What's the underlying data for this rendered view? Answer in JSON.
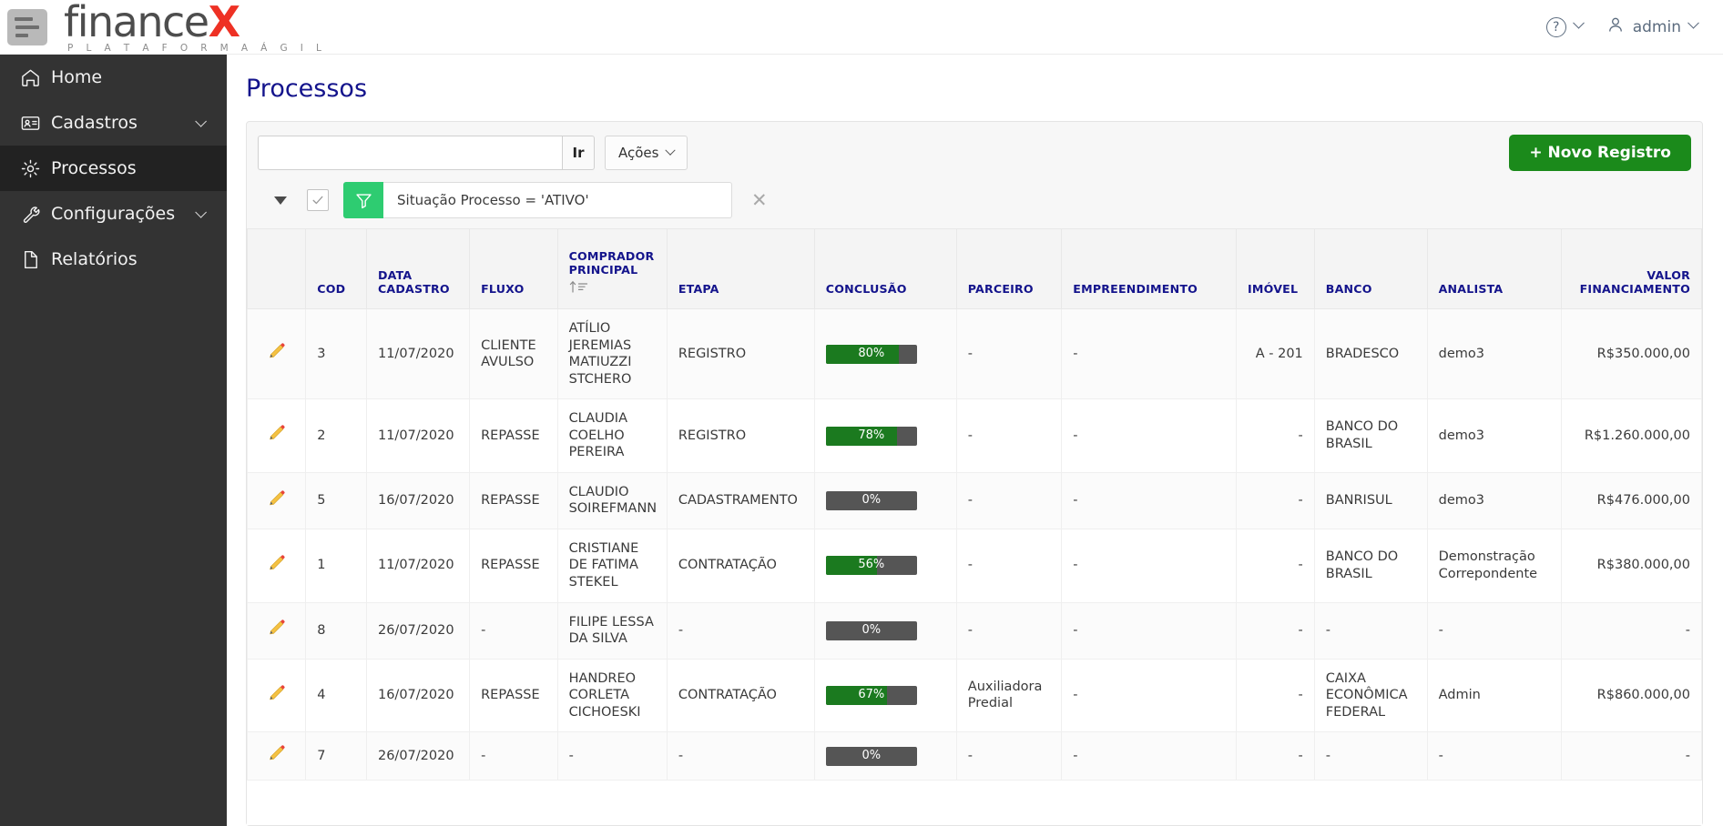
{
  "topbar": {
    "menu_icon": "hamburger-icon",
    "logo_main": "finance",
    "logo_x": "X",
    "logo_sub": "P L A T A F O R M A   Á G I L",
    "help_icon": "help-circle-icon",
    "help_glyph": "?",
    "user_icon": "user-icon",
    "user_label": "admin"
  },
  "sidebar": {
    "items": [
      {
        "label": "Home",
        "icon": "home-icon",
        "active": false,
        "has_chevron": false
      },
      {
        "label": "Cadastros",
        "icon": "id-card-icon",
        "active": false,
        "has_chevron": true
      },
      {
        "label": "Processos",
        "icon": "gear-icon",
        "active": true,
        "has_chevron": false
      },
      {
        "label": "Configurações",
        "icon": "wrench-icon",
        "active": false,
        "has_chevron": true
      },
      {
        "label": "Relatórios",
        "icon": "document-icon",
        "active": false,
        "has_chevron": false
      }
    ]
  },
  "page": {
    "title": "Processos"
  },
  "toolbar": {
    "search_value": "",
    "search_placeholder": "",
    "go_label": "Ir",
    "acoes_label": "Ações",
    "novo_registro_label": "+ Novo Registro"
  },
  "filter": {
    "toggle_icon": "triangle-down-icon",
    "checkbox_checked": true,
    "funnel_icon": "funnel-icon",
    "text": "Situação Processo = 'ATIVO'",
    "close_icon": "close-icon",
    "close_glyph": "✕"
  },
  "colors": {
    "accent_green": "#1b8a1b",
    "filter_green": "#2ecc71",
    "header_navy": "#14148c",
    "sidebar": "#333333",
    "sidebar_active": "#222222",
    "bar_track": "#555555",
    "bar_fill": "#1b7a1f",
    "logo_red": "#ee3124"
  },
  "table": {
    "columns": [
      {
        "key": "edit",
        "label": "",
        "align": "left",
        "sorted": false
      },
      {
        "key": "cod",
        "label": "COD",
        "align": "left",
        "sorted": false
      },
      {
        "key": "data",
        "label": "DATA CADASTRO",
        "align": "left",
        "sorted": false
      },
      {
        "key": "fluxo",
        "label": "FLUXO",
        "align": "left",
        "sorted": false
      },
      {
        "key": "comp",
        "label": "COMPRADOR PRINCIPAL",
        "align": "left",
        "sorted": true
      },
      {
        "key": "etapa",
        "label": "ETAPA",
        "align": "left",
        "sorted": false
      },
      {
        "key": "conc",
        "label": "CONCLUSÃO",
        "align": "left",
        "sorted": false
      },
      {
        "key": "parc",
        "label": "PARCEIRO",
        "align": "left",
        "sorted": false
      },
      {
        "key": "empr",
        "label": "EMPREENDIMENTO",
        "align": "left",
        "sorted": false
      },
      {
        "key": "imov",
        "label": "IMÓVEL",
        "align": "left",
        "sorted": false
      },
      {
        "key": "banco",
        "label": "BANCO",
        "align": "left",
        "sorted": false
      },
      {
        "key": "anal",
        "label": "ANALISTA",
        "align": "left",
        "sorted": false
      },
      {
        "key": "valor",
        "label": "VALOR FINANCIAMENTO",
        "align": "right",
        "sorted": false
      }
    ],
    "rows": [
      {
        "edit_icon": "pencil-icon",
        "cod": "3",
        "data": "11/07/2020",
        "fluxo": "CLIENTE AVULSO",
        "comp": "ATÍLIO JEREMIAS MATIUZZI STCHERO",
        "etapa": "REGISTRO",
        "conclusao_pct": 80,
        "conclusao_label": "80%",
        "parceiro": "-",
        "empreendimento": "-",
        "imovel": "A - 201",
        "banco": "BRADESCO",
        "analista": "demo3",
        "valor": "R$350.000,00"
      },
      {
        "edit_icon": "pencil-icon",
        "cod": "2",
        "data": "11/07/2020",
        "fluxo": "REPASSE",
        "comp": "CLAUDIA COELHO PEREIRA",
        "etapa": "REGISTRO",
        "conclusao_pct": 78,
        "conclusao_label": "78%",
        "parceiro": "-",
        "empreendimento": "-",
        "imovel": "-",
        "banco": "BANCO DO BRASIL",
        "analista": "demo3",
        "valor": "R$1.260.000,00"
      },
      {
        "edit_icon": "pencil-icon",
        "cod": "5",
        "data": "16/07/2020",
        "fluxo": "REPASSE",
        "comp": "CLAUDIO SOIREFMANN",
        "etapa": "CADASTRAMENTO",
        "conclusao_pct": 0,
        "conclusao_label": "0%",
        "parceiro": "-",
        "empreendimento": "-",
        "imovel": "-",
        "banco": "BANRISUL",
        "analista": "demo3",
        "valor": "R$476.000,00"
      },
      {
        "edit_icon": "pencil-icon",
        "cod": "1",
        "data": "11/07/2020",
        "fluxo": "REPASSE",
        "comp": "CRISTIANE DE FATIMA STEKEL",
        "etapa": "CONTRATAÇÃO",
        "conclusao_pct": 56,
        "conclusao_label": "56%",
        "parceiro": "-",
        "empreendimento": "-",
        "imovel": "-",
        "banco": "BANCO DO BRASIL",
        "analista": "Demonstração Correpondente",
        "valor": "R$380.000,00"
      },
      {
        "edit_icon": "pencil-icon",
        "cod": "8",
        "data": "26/07/2020",
        "fluxo": "-",
        "comp": "FILIPE LESSA DA SILVA",
        "etapa": "-",
        "conclusao_pct": 0,
        "conclusao_label": "0%",
        "parceiro": "-",
        "empreendimento": "-",
        "imovel": "-",
        "banco": "-",
        "analista": "-",
        "valor": "-"
      },
      {
        "edit_icon": "pencil-icon",
        "cod": "4",
        "data": "16/07/2020",
        "fluxo": "REPASSE",
        "comp": "HANDREO CORLETA CICHOESKI",
        "etapa": "CONTRATAÇÃO",
        "conclusao_pct": 67,
        "conclusao_label": "67%",
        "parceiro": "Auxiliadora Predial",
        "empreendimento": "-",
        "imovel": "-",
        "banco": "CAIXA ECONÔMICA FEDERAL",
        "analista": "Admin",
        "valor": "R$860.000,00"
      },
      {
        "edit_icon": "pencil-icon",
        "cod": "7",
        "data": "26/07/2020",
        "fluxo": "-",
        "comp": "-",
        "etapa": "-",
        "conclusao_pct": 0,
        "conclusao_label": "0%",
        "parceiro": "-",
        "empreendimento": "-",
        "imovel": "-",
        "banco": "-",
        "analista": "-",
        "valor": "-"
      }
    ]
  }
}
